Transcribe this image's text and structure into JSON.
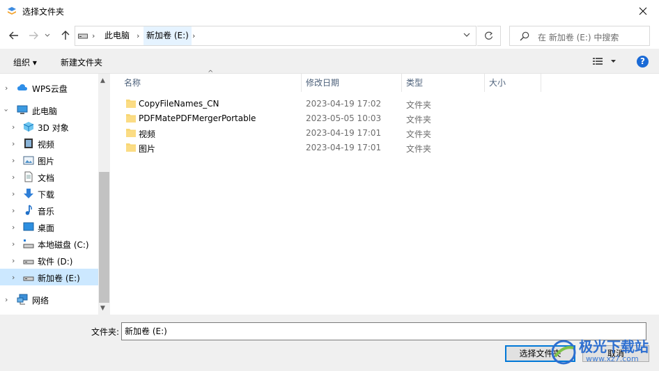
{
  "window": {
    "title": "选择文件夹"
  },
  "address": {
    "crumbs": [
      "此电脑",
      "新加卷 (E:)"
    ],
    "search_placeholder": "在 新加卷 (E:) 中搜索"
  },
  "toolbar": {
    "organize": "组织 ▾",
    "new_folder": "新建文件夹",
    "help": "?"
  },
  "sidebar": {
    "items": [
      {
        "label": "WPS云盘",
        "icon": "cloud-icon"
      },
      {
        "label": "此电脑",
        "icon": "computer-icon"
      },
      {
        "label": "3D 对象",
        "icon": "3d-objects-icon"
      },
      {
        "label": "视频",
        "icon": "video-icon"
      },
      {
        "label": "图片",
        "icon": "pictures-icon"
      },
      {
        "label": "文档",
        "icon": "documents-icon"
      },
      {
        "label": "下载",
        "icon": "download-icon"
      },
      {
        "label": "音乐",
        "icon": "music-icon"
      },
      {
        "label": "桌面",
        "icon": "desktop-icon"
      },
      {
        "label": "本地磁盘 (C:)",
        "icon": "system-drive-icon"
      },
      {
        "label": "软件 (D:)",
        "icon": "drive-icon"
      },
      {
        "label": "新加卷 (E:)",
        "icon": "drive-icon"
      },
      {
        "label": "网络",
        "icon": "network-icon"
      }
    ]
  },
  "columns": {
    "name": "名称",
    "date": "修改日期",
    "type": "类型",
    "size": "大小"
  },
  "files": [
    {
      "name": "CopyFileNames_CN",
      "date": "2023-04-19 17:02",
      "type": "文件夹"
    },
    {
      "name": "PDFMatePDFMergerPortable",
      "date": "2023-05-05 10:03",
      "type": "文件夹"
    },
    {
      "name": "视频",
      "date": "2023-04-19 17:01",
      "type": "文件夹"
    },
    {
      "name": "图片",
      "date": "2023-04-19 17:01",
      "type": "文件夹"
    }
  ],
  "footer": {
    "folder_label": "文件夹:",
    "folder_value": "新加卷 (E:)",
    "select_button": "选择文件夹",
    "cancel_button": "取消"
  },
  "watermark": {
    "line1": "极光下载站",
    "line2": "www.xz7.com"
  },
  "colors": {
    "selection": "#cce8ff",
    "accent": "#0078d7",
    "folder": "#f8d775"
  }
}
